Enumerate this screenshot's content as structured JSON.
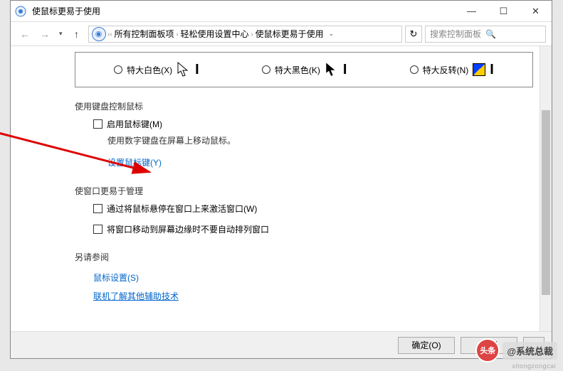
{
  "window": {
    "title": "使鼠标更易于使用"
  },
  "nav": {
    "breadcrumb": [
      "所有控制面板项",
      "轻松使用设置中心",
      "使鼠标更易于使用"
    ],
    "search_placeholder": "搜索控制面板"
  },
  "cursors": {
    "extra_white": "特大白色(X)",
    "extra_black": "特大黑色(K)",
    "extra_invert": "特大反转(N)"
  },
  "sections": {
    "keyboard_mouse_title": "使用键盘控制鼠标",
    "enable_mouse_keys": "启用鼠标键(M)",
    "mouse_keys_desc": "使用数字键盘在屏幕上移动鼠标。",
    "setup_mouse_keys": "设置鼠标键(Y)",
    "window_mgmt_title": "使窗口更易于管理",
    "hover_activate": "通过将鼠标悬停在窗口上来激活窗口(W)",
    "no_snap": "将窗口移动到屏幕边缘时不要自动排列窗口",
    "see_also_title": "另请参阅",
    "mouse_settings": "鼠标设置(S)",
    "learn_more": "联机了解其他辅助技术"
  },
  "buttons": {
    "ok": "确定(O)",
    "cancel": "取消"
  },
  "watermark": {
    "badge": "头条",
    "text": "@系统总裁",
    "sub": "xitongzongcai"
  }
}
